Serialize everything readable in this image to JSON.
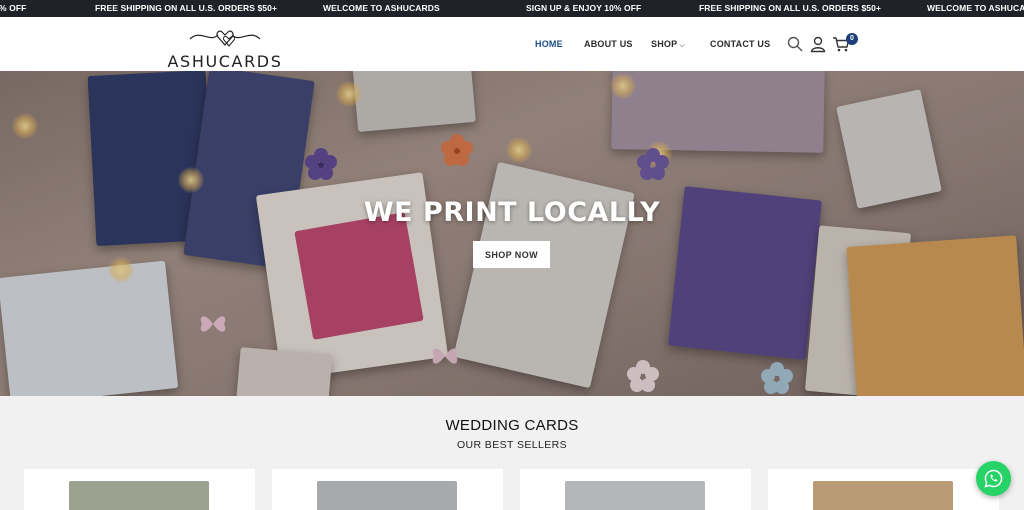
{
  "announcement": {
    "messages": [
      "% OFF",
      "FREE SHIPPING ON ALL U.S. ORDERS $50+",
      "WELCOME TO ASHUCARDS",
      "SIGN UP & ENJOY 10% OFF",
      "FREE SHIPPING ON ALL U.S. ORDERS $50+",
      "WELCOME TO ASHUCARDS"
    ]
  },
  "header": {
    "logo_text": "ASHUCARDS",
    "nav": [
      {
        "label": "HOME",
        "active": true
      },
      {
        "label": "ABOUT US",
        "active": false
      },
      {
        "label": "SHOP",
        "active": false,
        "has_dropdown": true
      },
      {
        "label": "CONTACT US",
        "active": false
      }
    ],
    "icons": [
      "search-icon",
      "user-icon",
      "cart-icon"
    ],
    "cart_count": "0"
  },
  "hero": {
    "title": "WE PRINT LOCALLY",
    "button_label": "SHOP NOW"
  },
  "section": {
    "title": "WEDDING CARDS",
    "subtitle": "OUR BEST SELLERS"
  },
  "colors": {
    "topbar": "#1f2329",
    "accent_nav": "#1d4e89",
    "cart_badge": "#1d3f7a",
    "whatsapp": "#25d366"
  }
}
